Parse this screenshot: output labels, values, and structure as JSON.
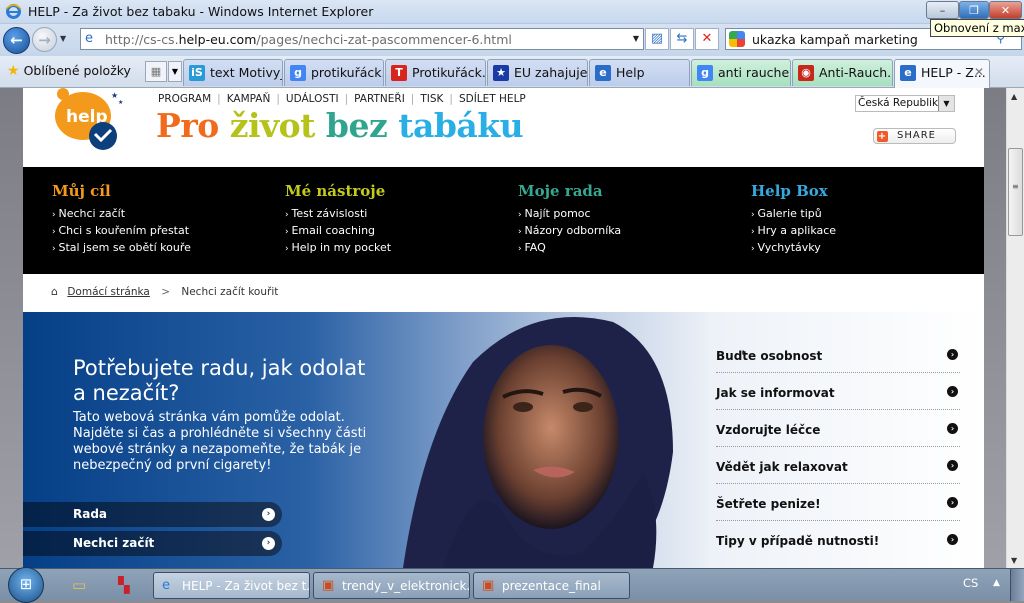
{
  "window": {
    "title": "HELP - Za život bez tabaku - Windows Internet Explorer",
    "minimize_label": "–",
    "maximize_label": "❐",
    "close_label": "✕",
    "tooltip": "Obnovení z max."
  },
  "navbar": {
    "back_icon": "←",
    "forward_icon": "→",
    "url_prefix": "http://cs-cs.",
    "url_domain": "help-eu.com",
    "url_path": "/pages/nechci-zat-pascommencer-6.html",
    "search_query": "ukazka kampaň marketing"
  },
  "favorites": {
    "label": "Oblíbené položky"
  },
  "tabs": [
    {
      "label": "text Motivy_...",
      "icon": "iS",
      "color": "#2a9ad6",
      "style": "normal"
    },
    {
      "label": "protikuřáck...",
      "icon": "g",
      "color": "#4285f4",
      "style": "normal"
    },
    {
      "label": "Protikuřáck...",
      "icon": "T",
      "color": "#d8241c",
      "style": "normal"
    },
    {
      "label": "EU zahajuje ...",
      "icon": "★",
      "color": "#1a3aa8",
      "style": "normal"
    },
    {
      "label": "Help",
      "icon": "e",
      "color": "#2a6cc8",
      "style": "normal"
    },
    {
      "label": "anti raucher...",
      "icon": "g",
      "color": "#4285f4",
      "style": "green"
    },
    {
      "label": "Anti-Rauch...",
      "icon": "◉",
      "color": "#c8281c",
      "style": "green"
    },
    {
      "label": "HELP - Z...",
      "icon": "e",
      "color": "#2a6cc8",
      "style": "active"
    }
  ],
  "site": {
    "logo_text": "help",
    "topnav": [
      "PROGRAM",
      "KAMPAŇ",
      "UDÁLOSTI",
      "PARTNEŘI",
      "TISK",
      "SDÍLET HELP"
    ],
    "slogan": [
      {
        "text": "Pro ",
        "color": "#f26a1b"
      },
      {
        "text": "život ",
        "color": "#b5c21a"
      },
      {
        "text": "bez ",
        "color": "#2fa58f"
      },
      {
        "text": "tabáku",
        "color": "#2aaee6"
      }
    ],
    "country": "Česká Republika",
    "share_label": "SHARE"
  },
  "mega_menu": [
    {
      "title": "Můj cíl",
      "color": "#f39a1d",
      "items": [
        "Nechci začít",
        "Chci s kouřením přestat",
        "Stal jsem se obětí kouře"
      ]
    },
    {
      "title": "Mé nástroje",
      "color": "#c3cb1c",
      "items": [
        "Test závislosti",
        "Email coaching",
        "Help in my pocket"
      ]
    },
    {
      "title": "Moje rada",
      "color": "#34a890",
      "items": [
        "Najít pomoc",
        "Názory odborníka",
        "FAQ"
      ]
    },
    {
      "title": "Help Box",
      "color": "#35a9e0",
      "items": [
        "Galerie tipů",
        "Hry a aplikace",
        "Vychytávky"
      ]
    }
  ],
  "breadcrumb": {
    "home": "Domácí stránka",
    "current": "Nechci začít kouřit"
  },
  "hero": {
    "heading": "Potřebujete radu, jak odolat a nezačít?",
    "body": "Tato webová stránka vám pomůže odolat. Najděte si čas a prohlédněte si všechny části webové stránky a nezapomeňte, že tabák je nebezpečný od první cigarety!",
    "pills": [
      "Rada",
      "Nechci začít"
    ],
    "links": [
      "Buďte osobnost",
      "Jak se informovat",
      "Vzdorujte léčce",
      "Vědět jak relaxovat",
      "Šetřete penize!",
      "Tipy v případě nutnosti!"
    ]
  },
  "taskbar": {
    "tasks": [
      {
        "label": "HELP - Za život bez t...",
        "icon": "e",
        "active": true
      },
      {
        "label": "trendy_v_elektronick...",
        "icon": "▣",
        "active": false
      },
      {
        "label": "prezentace_final",
        "icon": "▣",
        "active": false
      }
    ],
    "language": "CS"
  }
}
